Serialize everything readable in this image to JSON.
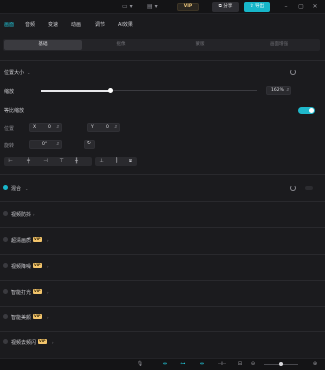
{
  "topbar": {
    "vip_label": "VIP",
    "share_label": "分享",
    "export_label": "导出"
  },
  "nav": {
    "tabs": [
      "画面",
      "音频",
      "变速",
      "动画",
      "调节",
      "AI效果"
    ],
    "active_index": 0
  },
  "subtabs": [
    "基础",
    "抠像",
    "蒙版",
    "画面增强"
  ],
  "transform": {
    "section_title": "位置大小",
    "scale_label": "缩放",
    "scale_value": "162%",
    "scale_fraction": 0.32,
    "uniform_scale_label": "等比缩放",
    "uniform_scale_on": true,
    "position_label": "位置",
    "pos_x_axis": "X",
    "pos_x_value": "0",
    "pos_y_axis": "Y",
    "pos_y_value": "0",
    "rotate_label": "旋转",
    "rotate_value": "0°"
  },
  "sections": [
    {
      "label": "混合",
      "checked": true,
      "vip": false
    },
    {
      "label": "视频防抖",
      "checked": false,
      "vip": false
    },
    {
      "label": "超清画质",
      "checked": false,
      "vip": true
    },
    {
      "label": "视频降噪",
      "checked": false,
      "vip": true
    },
    {
      "label": "智能打光",
      "checked": false,
      "vip": true
    },
    {
      "label": "智能美颜",
      "checked": false,
      "vip": true
    },
    {
      "label": "视频去频闪",
      "checked": false,
      "vip": true
    }
  ],
  "vip_tag": "VIP",
  "colors": {
    "accent": "#19b6ca",
    "vip": "#f2c46b",
    "background": "#1b1b1e"
  }
}
